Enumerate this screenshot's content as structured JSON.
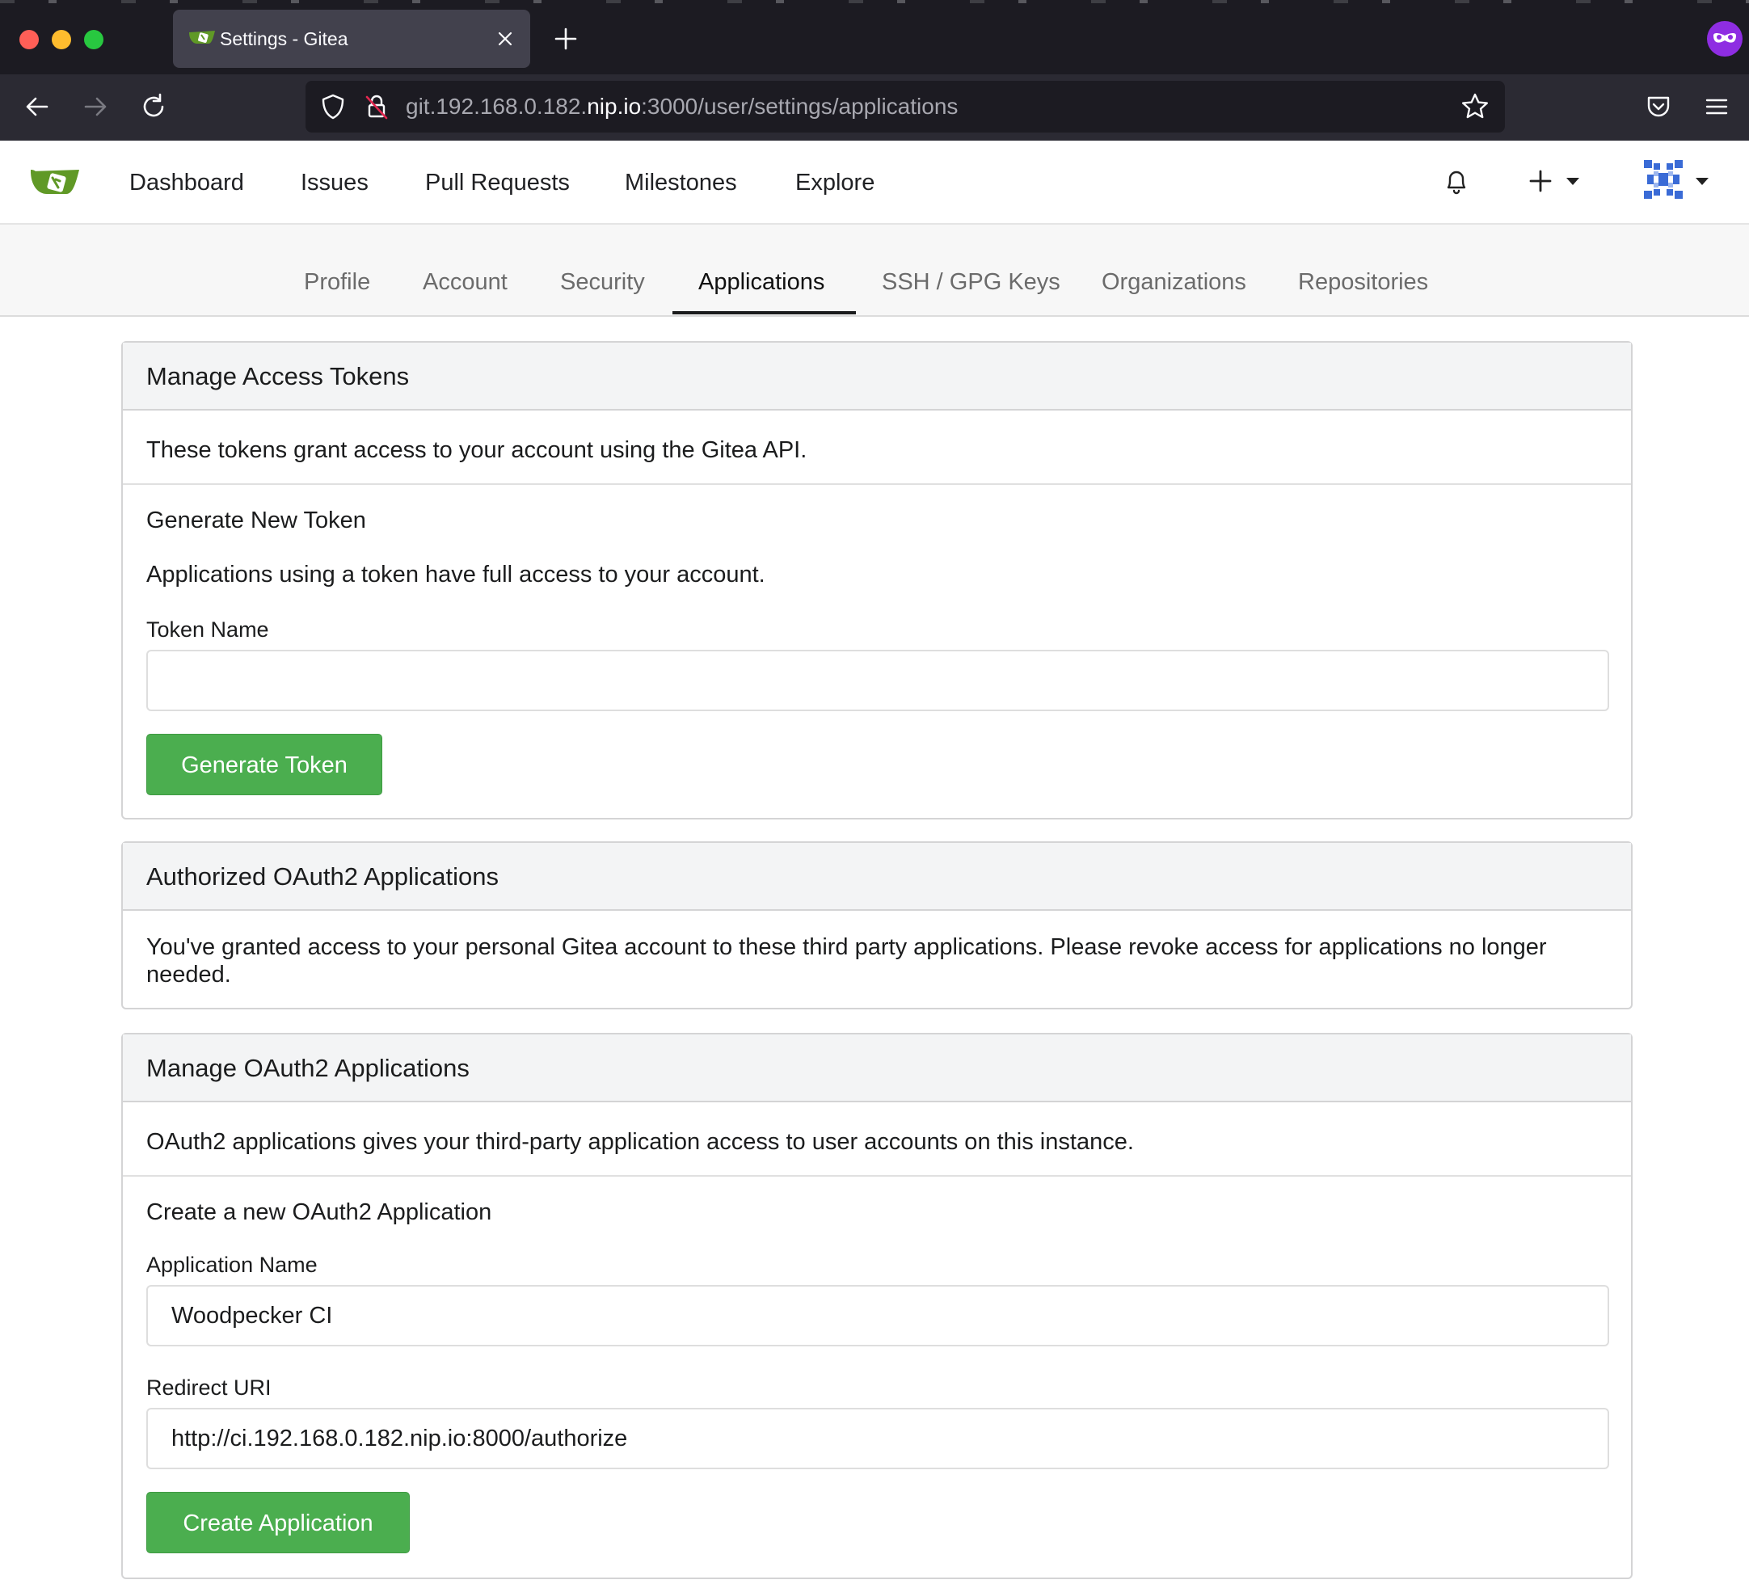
{
  "browser": {
    "tab_title": "Settings - Gitea",
    "url_prefix": "git.192.168.0.182.",
    "url_host": "nip.io",
    "url_suffix": ":3000/user/settings/applications"
  },
  "header": {
    "nav": [
      "Dashboard",
      "Issues",
      "Pull Requests",
      "Milestones",
      "Explore"
    ]
  },
  "settings_tabs": {
    "items": [
      "Profile",
      "Account",
      "Security",
      "Applications",
      "SSH / GPG Keys",
      "Organizations",
      "Repositories"
    ],
    "active": "Applications"
  },
  "access_tokens": {
    "title": "Manage Access Tokens",
    "description": "These tokens grant access to your account using the Gitea API.",
    "generate_heading": "Generate New Token",
    "generate_note": "Applications using a token have full access to your account.",
    "token_name_label": "Token Name",
    "token_name_value": "",
    "generate_button": "Generate Token"
  },
  "authorized_oauth2": {
    "title": "Authorized OAuth2 Applications",
    "description": "You've granted access to your personal Gitea account to these third party applications. Please revoke access for applications no longer needed."
  },
  "manage_oauth2": {
    "title": "Manage OAuth2 Applications",
    "description": "OAuth2 applications gives your third-party application access to user accounts on this instance.",
    "create_heading": "Create a new OAuth2 Application",
    "app_name_label": "Application Name",
    "app_name_value": "Woodpecker CI",
    "redirect_label": "Redirect URI",
    "redirect_value": "http://ci.192.168.0.182.nip.io:8000/authorize",
    "create_button": "Create Application"
  },
  "colors": {
    "accent_green": "#4bae4f",
    "gitea_logo_green": "#609926",
    "active_tab_underline": "#1b1c1d"
  }
}
